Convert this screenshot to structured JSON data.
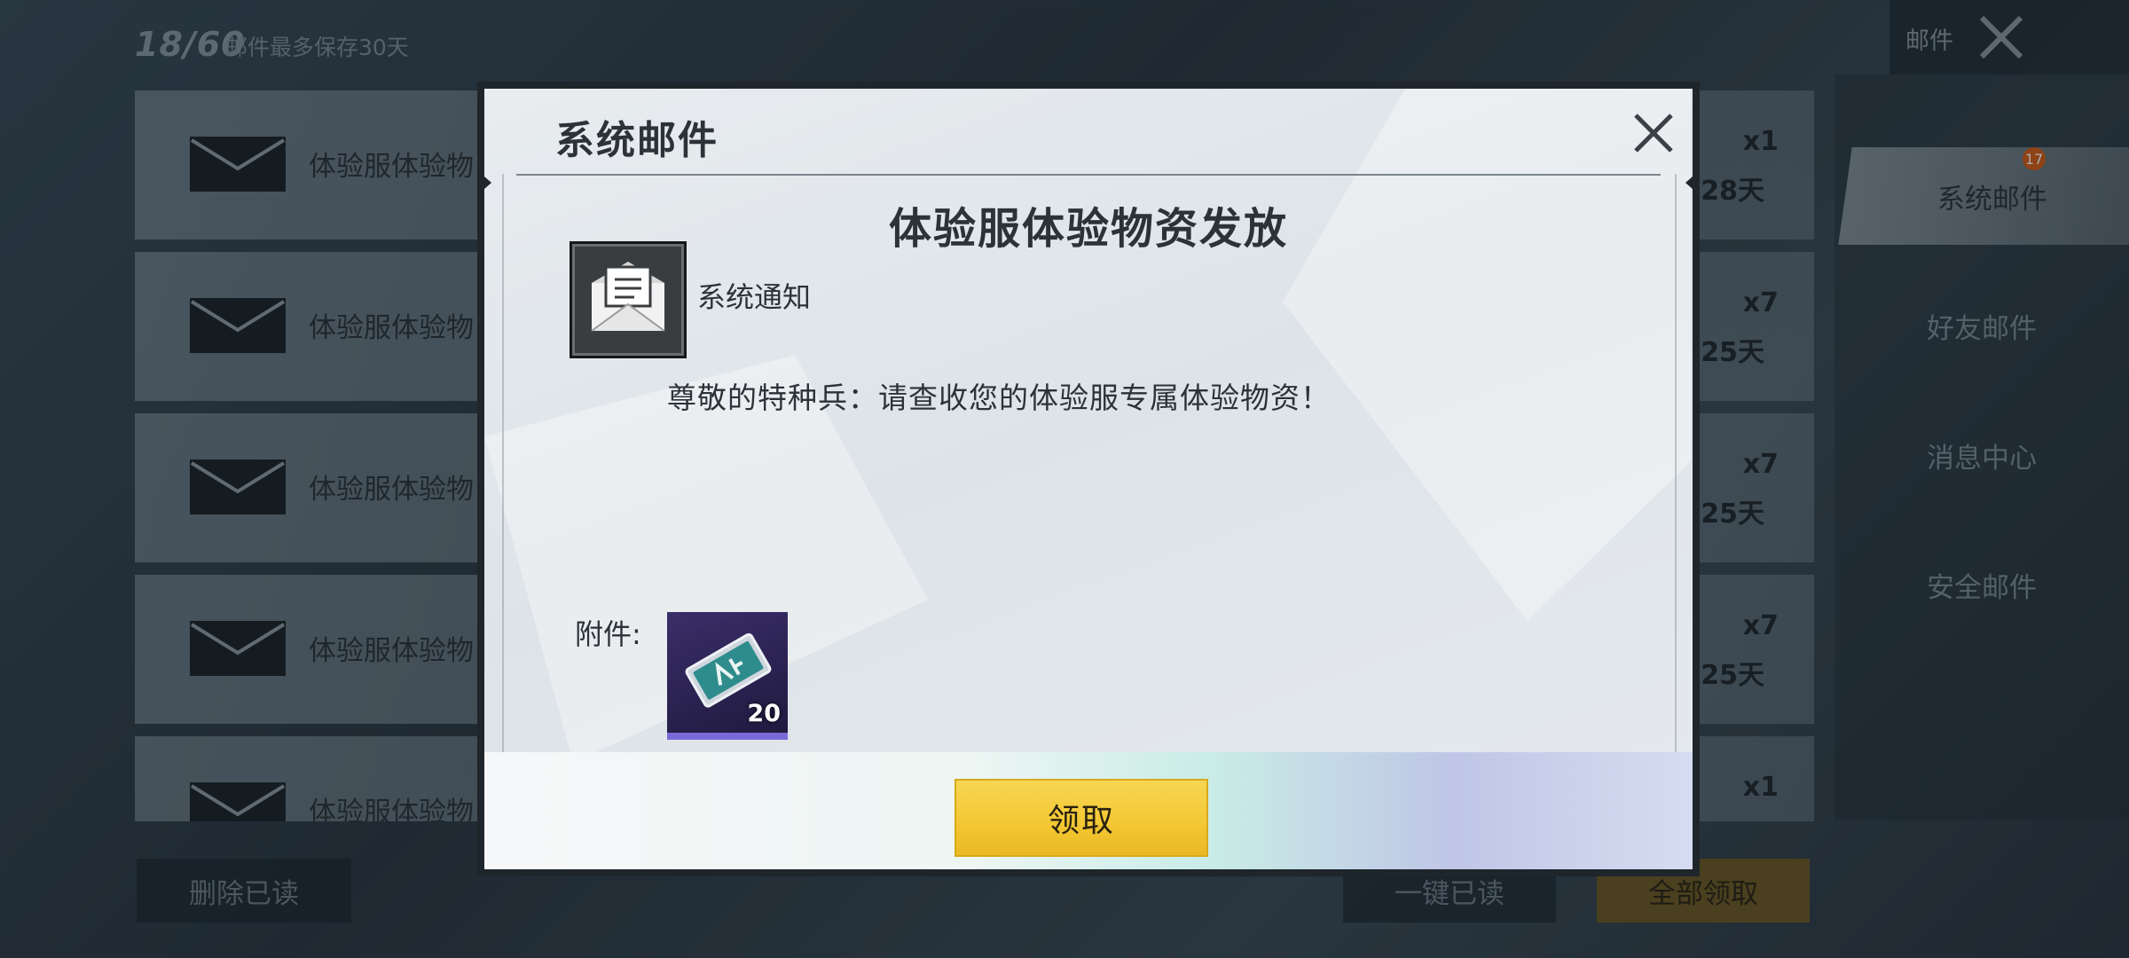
{
  "background": {
    "mail_count": "18/60",
    "retention_note": "邮件最多保存30天",
    "window_title": "邮件",
    "mails": [
      {
        "title": "体验服体验物",
        "count": "x1",
        "days": "28天"
      },
      {
        "title": "体验服体验物",
        "count": "x7",
        "days": "25天"
      },
      {
        "title": "体验服体验物",
        "count": "x7",
        "days": "25天"
      },
      {
        "title": "体验服体验物",
        "count": "x7",
        "days": "25天"
      },
      {
        "title": "体验服体验物",
        "count": "x1",
        "days": ""
      }
    ],
    "tabs": [
      {
        "label": "系统邮件",
        "badge": "17"
      },
      {
        "label": "好友邮件"
      },
      {
        "label": "消息中心"
      },
      {
        "label": "安全邮件"
      }
    ],
    "buttons": {
      "delete_read": "删除已读",
      "mark_all_read": "一键已读",
      "claim_all": "全部领取"
    }
  },
  "dialog": {
    "title": "系统邮件",
    "heading": "体验服体验物资发放",
    "sender": "系统通知",
    "body": "尊敬的特种兵：请查收您的体验服专属体验物资！",
    "attachment_label": "附件:",
    "attachment": {
      "icon": "ticket-card-icon",
      "quantity": "20"
    },
    "claim_button": "领取"
  },
  "colors": {
    "accent_gold": "#f3c733",
    "dialog_bg": "#e6eaee",
    "badge": "#d85c14",
    "item_bg": "#2a2250"
  }
}
